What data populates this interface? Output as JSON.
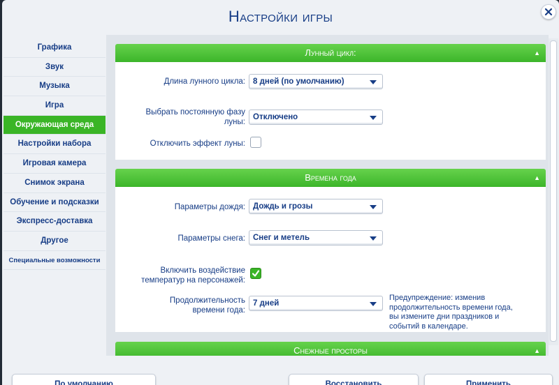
{
  "window": {
    "title": "Настройки игры"
  },
  "sidebar": {
    "items": [
      {
        "label": "Графика"
      },
      {
        "label": "Звук"
      },
      {
        "label": "Музыка"
      },
      {
        "label": "Игра"
      },
      {
        "label": "Окружающая среда",
        "active": true
      },
      {
        "label": "Настройки набора"
      },
      {
        "label": "Игровая камера"
      },
      {
        "label": "Снимок экрана"
      },
      {
        "label": "Обучение и подсказки"
      },
      {
        "label": "Экспресс-доставка"
      },
      {
        "label": "Другое"
      },
      {
        "label": "Специальные возможности"
      }
    ]
  },
  "lunar": {
    "header": "Лунный цикл:",
    "cycle_length_label": "Длина лунного цикла:",
    "cycle_length_value": "8 дней (по умолчанию)",
    "fixed_phase_label_1": "Выбрать постоянную фазу",
    "fixed_phase_label_2": "луны:",
    "fixed_phase_value": "Отключено",
    "disable_effect_label": "Отключить эффект луны:",
    "disable_effect_checked": false
  },
  "seasons": {
    "header": "Времена года",
    "rain_label": "Параметры дождя:",
    "rain_value": "Дождь и грозы",
    "snow_label": "Параметры снега:",
    "snow_value": "Снег и метель",
    "temp_label_1": "Включить воздействие",
    "temp_label_2": "температур на персонажей:",
    "temp_checked": true,
    "length_label_1": "Продолжительность",
    "length_label_2": "времени года:",
    "length_value": "7 дней",
    "warning_1": "Предупреждение: изменив",
    "warning_2": "продолжительность времени года,",
    "warning_3": "вы измените дни праздников и",
    "warning_4": "событий в календаре."
  },
  "snowy": {
    "header": "Снежные просторы"
  },
  "footer": {
    "default_label": "По умолчанию",
    "restore_label": "Восстановить",
    "apply_label": "Применить"
  },
  "colors": {
    "accent": "#3ab526",
    "text": "#173d86"
  },
  "icons": {
    "close": "close-icon",
    "collapse": "chevron-up-icon",
    "dropdown": "chevron-down-icon",
    "check": "checkmark-icon"
  }
}
